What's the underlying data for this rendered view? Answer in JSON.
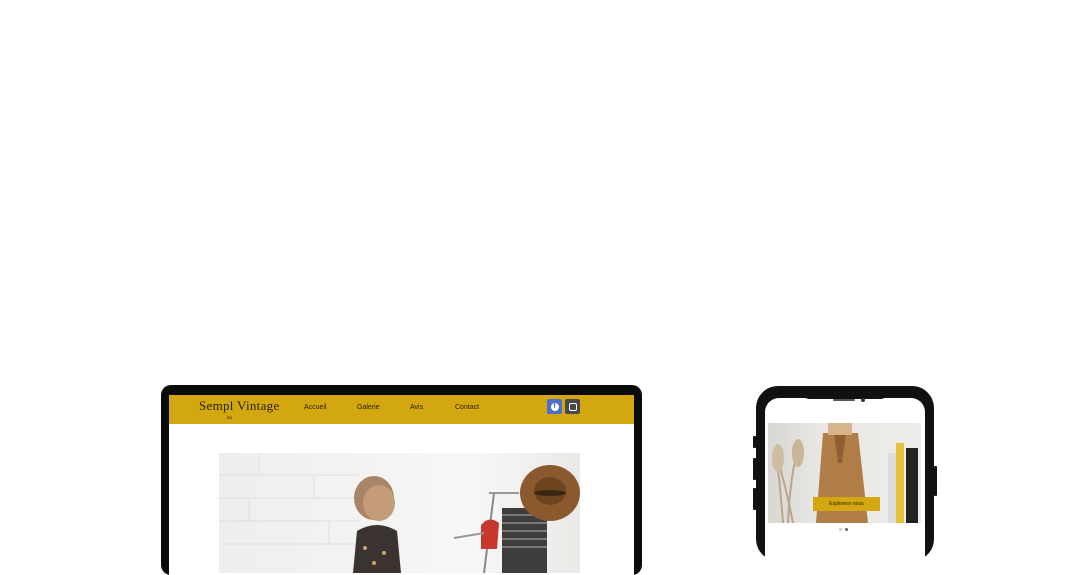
{
  "site": {
    "logo_text": "Sempl Vintage",
    "logo_sub": "ba",
    "nav": [
      "Accueil",
      "Galerie",
      "Avis",
      "Contact"
    ],
    "social_icons": [
      "facebook-icon",
      "instagram-icon"
    ],
    "brand_color": "#d3a70f"
  },
  "mobile": {
    "cta_label": "Exploresn nous"
  }
}
